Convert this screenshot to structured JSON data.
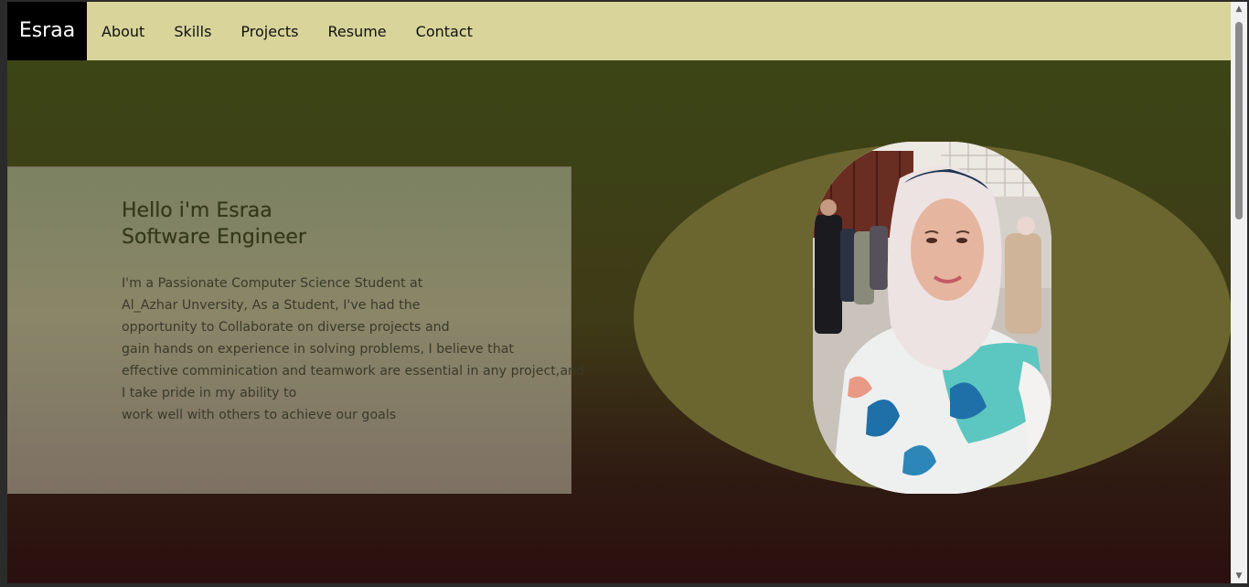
{
  "navbar": {
    "brand": "Esraa",
    "links": [
      "About",
      "Skills",
      "Projects",
      "Resume",
      "Contact"
    ]
  },
  "intro": {
    "heading_line1": "Hello i'm Esraa",
    "heading_line2": "Software Engineer",
    "body_lines": [
      "I'm a Passionate Computer Science Student at",
      "Al_Azhar Unversity, As a Student, I've had the",
      "opportunity to Collaborate on diverse projects and",
      "gain hands on experience in solving problems, I believe that",
      "effective comminication and teamwork are essential in any project,and",
      "I take pride in my ability to",
      "work well with others to achieve our goals"
    ]
  },
  "colors": {
    "navbar_bg": "#d8d49a",
    "brand_bg": "#000000",
    "ellipse": "#6b6630",
    "heading": "#34391a"
  }
}
